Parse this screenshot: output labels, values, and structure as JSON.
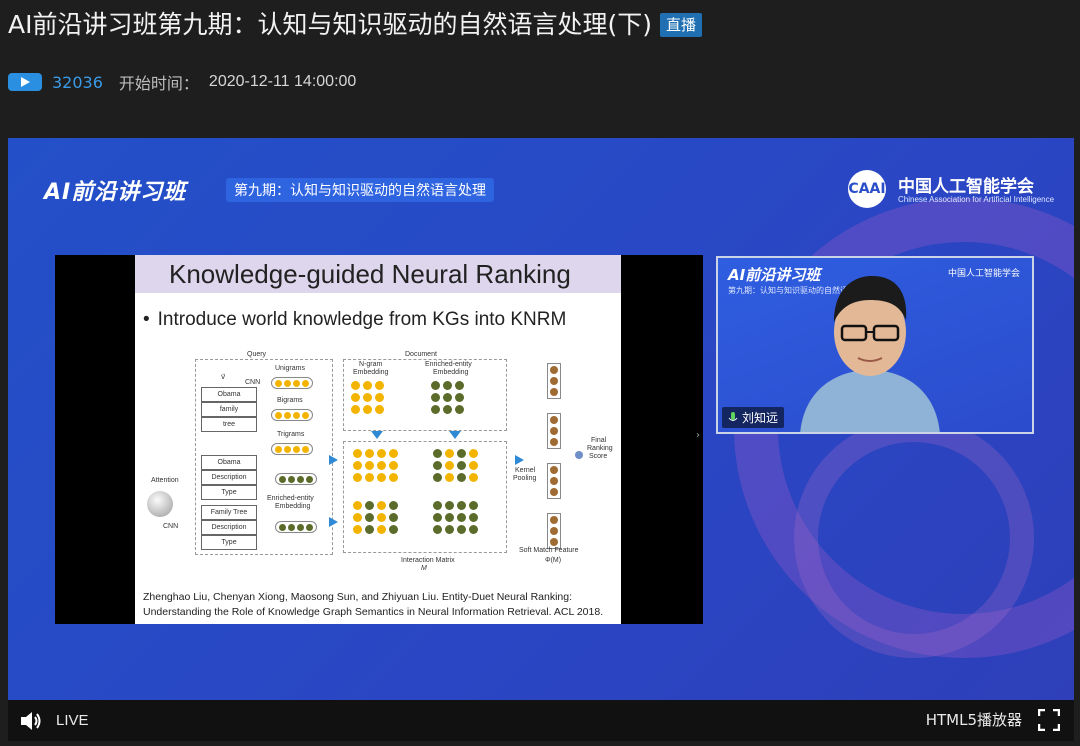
{
  "header": {
    "title": "AI前沿讲习班第九期：认知与知识驱动的自然语言处理(下)",
    "badge": "直播",
    "views": "32036",
    "start_label": "开始时间：",
    "start_time": "2020-12-11 14:00:00"
  },
  "banner": {
    "brand": "AI前沿讲习班",
    "session": "第九期：认知与知识驱动的自然语言处理",
    "org_logo": "CAAI",
    "org_cn": "中国人工智能学会",
    "org_en": "Chinese Association for Artificial Intelligence"
  },
  "slide": {
    "title": "Knowledge-guided Neural Ranking",
    "bullet": "Introduce world knowledge from KGs into KNRM",
    "fig": {
      "query": "Query",
      "document": "Document",
      "cnn": "CNN",
      "unigrams": "Unigrams",
      "bigrams": "Bigrams",
      "trigrams": "Trigrams",
      "obama": "Obama",
      "family": "family",
      "tree": "tree",
      "obama2": "Obama",
      "description": "Description",
      "type": "Type",
      "family_tree": "Family Tree",
      "description2": "Description",
      "type2": "Type",
      "attention": "Attention",
      "cnn2": "CNN",
      "enriched_entity": "Enriched-entity",
      "embedding": "Embedding",
      "ngram": "N-gram",
      "ngram_emb": "Embedding",
      "enriched2": "Enriched-entity",
      "embedding2": "Embedding",
      "kernel": "Kernel",
      "pooling": "Pooling",
      "final": "Final",
      "ranking": "Ranking",
      "score": "Score",
      "interaction": "Interaction Matrix",
      "m": "M",
      "soft_match": "Soft Match Feature",
      "phi": "Φ(M)"
    },
    "citation_1": "Zhenghao Liu, Chenyan Xiong, Maosong Sun, and Zhiyuan Liu. Entity-Duet Neural Ranking:",
    "citation_2": "Understanding the Role of Knowledge Graph Semantics in Neural Information Retrieval. ACL 2018."
  },
  "camera": {
    "brand": "AI前沿讲习班",
    "sub": "第九期：认知与知识驱动的自然语言处理",
    "logo": "中国人工智能学会",
    "speaker": "刘知远"
  },
  "controls": {
    "live": "LIVE",
    "player": "HTML5播放器"
  },
  "colors": {
    "accent": "#2a8fe0",
    "stage": "#2a4cc6",
    "badge": "#1f6fb2"
  }
}
